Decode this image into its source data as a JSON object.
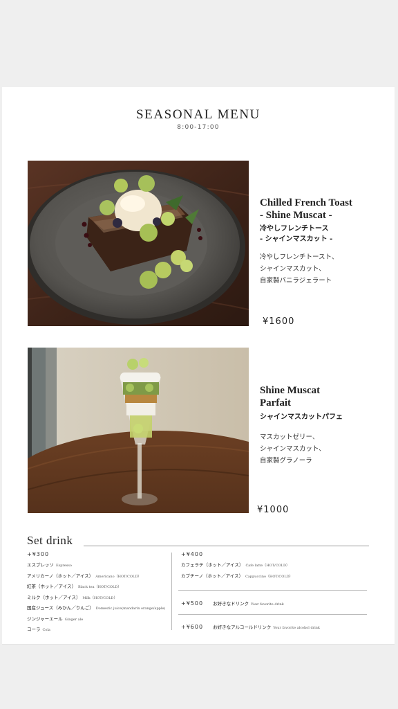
{
  "menu": {
    "title": "SEASONAL MENU",
    "hours": "8:00-17:00"
  },
  "items": [
    {
      "name_line1": "Chilled French Toast",
      "name_line2": "- Shine Muscat -",
      "ja_line1": "冷やしフレンチトース",
      "ja_line2": "- シャインマスカット -",
      "desc": [
        "冷やしフレンチトースト、",
        "シャインマスカット、",
        "自家製バニラジェラート"
      ],
      "price": "¥1600"
    },
    {
      "name_line1": "Shine Muscat",
      "name_line2": "Parfait",
      "ja_line1": "シャインマスカットパフェ",
      "desc": [
        "マスカットゼリー、",
        "シャインマスカット、",
        "自家製グラノーラ"
      ],
      "price": "¥1000"
    }
  ],
  "set_drink": {
    "title": "Set drink",
    "group300": {
      "price": "+¥300",
      "rows": [
        {
          "ja": "エスプレッソ",
          "en": "Espresso"
        },
        {
          "ja": "アメリカーノ（ホット／アイス）",
          "en": "Americano（HOT/COLD）"
        },
        {
          "ja": "紅茶（ホット／アイス）",
          "en": "Black tea（HOT/COLD）"
        },
        {
          "ja": "ミルク（ホット／アイス）",
          "en": "Milk（HOT/COLD）"
        },
        {
          "ja": "国産ジュース（みかん／りんご）",
          "en": "Domestic juice(mandarin orange/apple)"
        },
        {
          "ja": "ジンジャーエール",
          "en": "Ginger ale"
        },
        {
          "ja": "コーラ",
          "en": "Cola"
        }
      ]
    },
    "group400": {
      "price": "+¥400",
      "rows": [
        {
          "ja": "カフェラテ（ホット／アイス）",
          "en": "Cafe latte（HOT/COLD）"
        },
        {
          "ja": "カプチーノ（ホット／アイス）",
          "en": "Cappuccino（HOT/COLD）"
        }
      ]
    },
    "group500": {
      "price": "+¥500",
      "ja": "お好きなドリンク",
      "en": "Your favorite drink"
    },
    "group600": {
      "price": "+¥600",
      "ja": "お好きなアルコールドリンク",
      "en": "Your favorite alcohol drink"
    }
  }
}
